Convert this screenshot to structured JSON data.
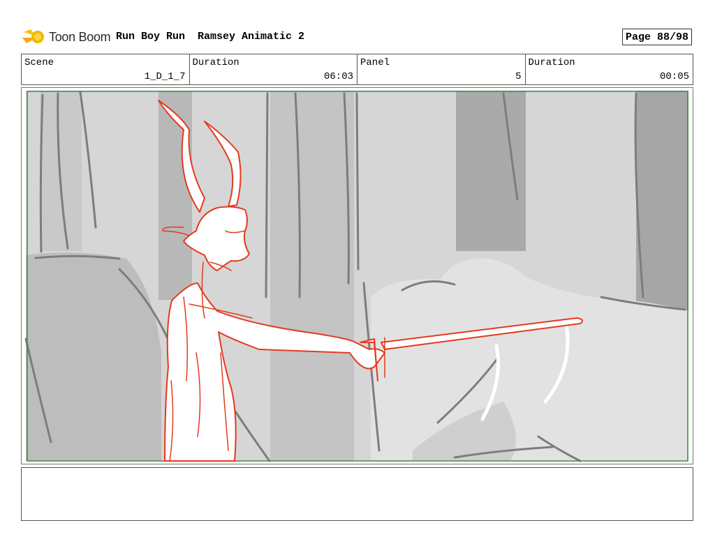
{
  "header": {
    "logo_text": "Toon Boom",
    "project": "Run Boy Run  Ramsey Animatic 2",
    "page": "Page 88/98"
  },
  "info": [
    {
      "label": "Scene",
      "value": "1_D_1_7"
    },
    {
      "label": "Duration",
      "value": "06:03"
    },
    {
      "label": "Panel",
      "value": "5"
    },
    {
      "label": "Duration",
      "value": "00:05"
    }
  ],
  "colors": {
    "sketch_red": "#e5391f",
    "safe_frame_green": "#3e8a3e",
    "logo_yellow": "#f5b800"
  },
  "notes": ""
}
